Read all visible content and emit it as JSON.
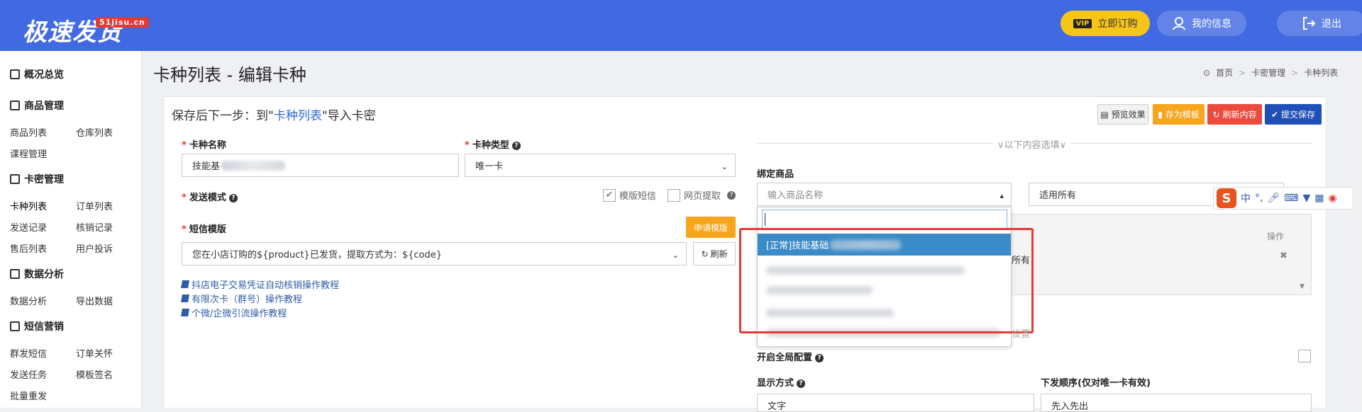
{
  "brand": {
    "logo": "极速发货",
    "badge": "51jisu.cn"
  },
  "topnav": {
    "vip": "立即订购",
    "vip_tag": "VIP",
    "my_info": "我的信息",
    "logout": "退出"
  },
  "sidebar": {
    "overview": "概况总览",
    "goods_mgmt": "商品管理",
    "goods_list": "商品列表",
    "warehouse_list": "仓库列表",
    "course_mgmt": "课程管理",
    "card_mgmt": "卡密管理",
    "card_list": "卡种列表",
    "order_list": "订单列表",
    "send_records": "发送记录",
    "verify_records": "核销记录",
    "aftersale_list": "售后列表",
    "user_complaints": "用户投诉",
    "data_analysis_head": "数据分析",
    "data_analysis": "数据分析",
    "export_data": "导出数据",
    "sms_marketing": "短信营销",
    "mass_sms": "群发短信",
    "order_care": "订单关怀",
    "send_tasks": "发送任务",
    "template_sign": "模板签名",
    "batch_resend": "批量重发"
  },
  "page": {
    "title": "卡种列表 - 编辑卡种"
  },
  "breadcrumb": [
    "首页",
    "卡密管理",
    "卡种列表"
  ],
  "panel": {
    "title_pre": "保存后下一步：到\"",
    "title_link": "卡种列表",
    "title_post": "\"导入卡密",
    "buttons": {
      "preview": "预览效果",
      "save_tpl": "存为模板",
      "refresh": "刷新内容",
      "submit": "提交保存"
    }
  },
  "form": {
    "card_name_label": "卡种名称",
    "card_name_value": "技能基",
    "card_type_label": "卡种类型",
    "card_type_value": "唯一卡",
    "send_mode_label": "发送模式",
    "opt_sms_tpl": "模版短信",
    "opt_web_pick": "网页提取",
    "sms_tpl_label": "短信模版",
    "apply_tpl": "申请模版",
    "sms_tpl_value": "您在小店订购的${product}已发货，提取方式为：${code}",
    "sms_refresh": "刷新",
    "tutorials": [
      "抖店电子交易凭证自动核销操作教程",
      "有限次卡（群号）操作教程",
      "个微/企微引流操作教程"
    ]
  },
  "right": {
    "optional_divider": "∨以下内容选填∨",
    "bind_goods_label": "绑定商品",
    "goods_placeholder": "输入商品名称",
    "applies_all": "适用所有",
    "col_action": "操作",
    "row_all": "所有",
    "dropdown_selected": "[正常]技能基础",
    "settings_fragment": "设置",
    "global_config_label": "开启全局配置",
    "display_mode_label": "显示方式",
    "display_mode_value": "文字",
    "order_label": "下发顺序(仅对唯一卡有效)",
    "order_value": "先入先出"
  },
  "ime": {
    "logo": "S",
    "lang": "中",
    "punct": "°,"
  }
}
